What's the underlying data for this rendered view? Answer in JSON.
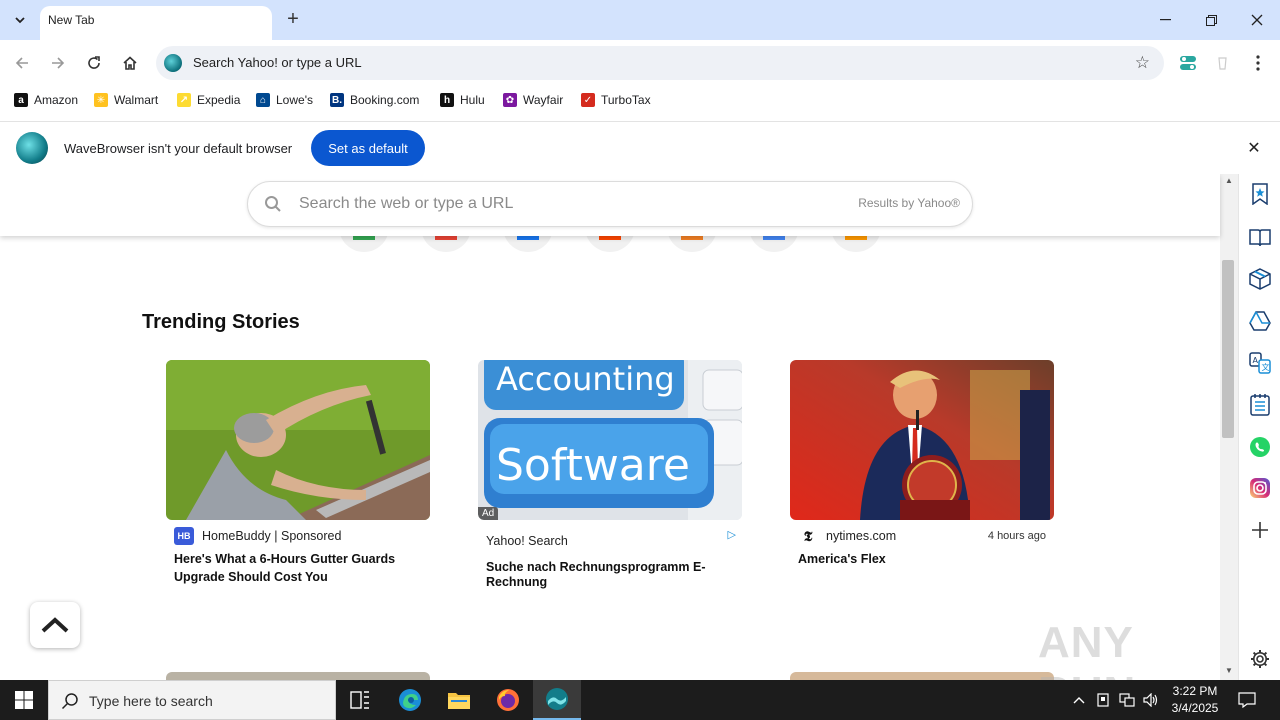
{
  "browser": {
    "tab_title": "New Tab",
    "new_tab_symbol": "+",
    "omnibox_text": "Search Yahoo! or type a URL"
  },
  "bookmarks": [
    {
      "label": "Amazon",
      "icon": "amazon-icon",
      "color": "#111111",
      "glyph": "a"
    },
    {
      "label": "Walmart",
      "icon": "walmart-icon",
      "color": "#ffc220",
      "glyph": "✳"
    },
    {
      "label": "Expedia",
      "icon": "expedia-icon",
      "color": "#fddb32",
      "glyph": "↗"
    },
    {
      "label": "Lowe's",
      "icon": "lowes-icon",
      "color": "#004990",
      "glyph": "⌂"
    },
    {
      "label": "Booking.com",
      "icon": "booking-icon",
      "color": "#003580",
      "glyph": "B."
    },
    {
      "label": "Hulu",
      "icon": "hulu-icon",
      "color": "#111111",
      "glyph": "h"
    },
    {
      "label": "Wayfair",
      "icon": "wayfair-icon",
      "color": "#7b189f",
      "glyph": "✿"
    },
    {
      "label": "TurboTax",
      "icon": "turbotax-icon",
      "color": "#d52b1e",
      "glyph": "✓"
    }
  ],
  "infobar": {
    "message": "WaveBrowser isn't your default browser",
    "button_label": "Set as default",
    "close_symbol": "✕"
  },
  "search": {
    "placeholder": "Search the web or type a URL",
    "provider": "Results by Yahoo®"
  },
  "quick_links": [
    {
      "name": "quick-link-1",
      "color": "#34a853"
    },
    {
      "name": "quick-link-2",
      "color": "#ea4335"
    },
    {
      "name": "quick-link-3",
      "color": "#1877f2"
    },
    {
      "name": "quick-link-4",
      "color": "#ff4500"
    },
    {
      "name": "quick-link-5",
      "color": "#f48024"
    },
    {
      "name": "quick-link-6",
      "color": "#4285f4"
    },
    {
      "name": "quick-link-7",
      "color": "#ff9900"
    }
  ],
  "trending": {
    "title": "Trending Stories",
    "cards": [
      {
        "source": "HomeBuddy | Sponsored",
        "source_icon": "HB",
        "icon_color": "#3a5bd9",
        "time": "",
        "title": "Here's What a 6-Hours Gutter Guards Upgrade Should Cost You",
        "ad_badge": ""
      },
      {
        "source": "Yahoo! Search",
        "source_icon": "",
        "icon_color": "",
        "time": "",
        "title": "Suche nach Rechnungsprogramm E-Rechnung",
        "ad_badge": "Ad",
        "image_text_1": "Accounting",
        "image_text_2": "Software"
      },
      {
        "source": "nytimes.com",
        "source_icon": "𝕿",
        "icon_color": "#ffffff",
        "time": "4 hours ago",
        "title": "America's Flex",
        "ad_badge": ""
      }
    ]
  },
  "watermark": "ANY RUN",
  "taskbar": {
    "search_placeholder": "Type here to search",
    "time": "3:22 PM",
    "date": "3/4/2025"
  }
}
